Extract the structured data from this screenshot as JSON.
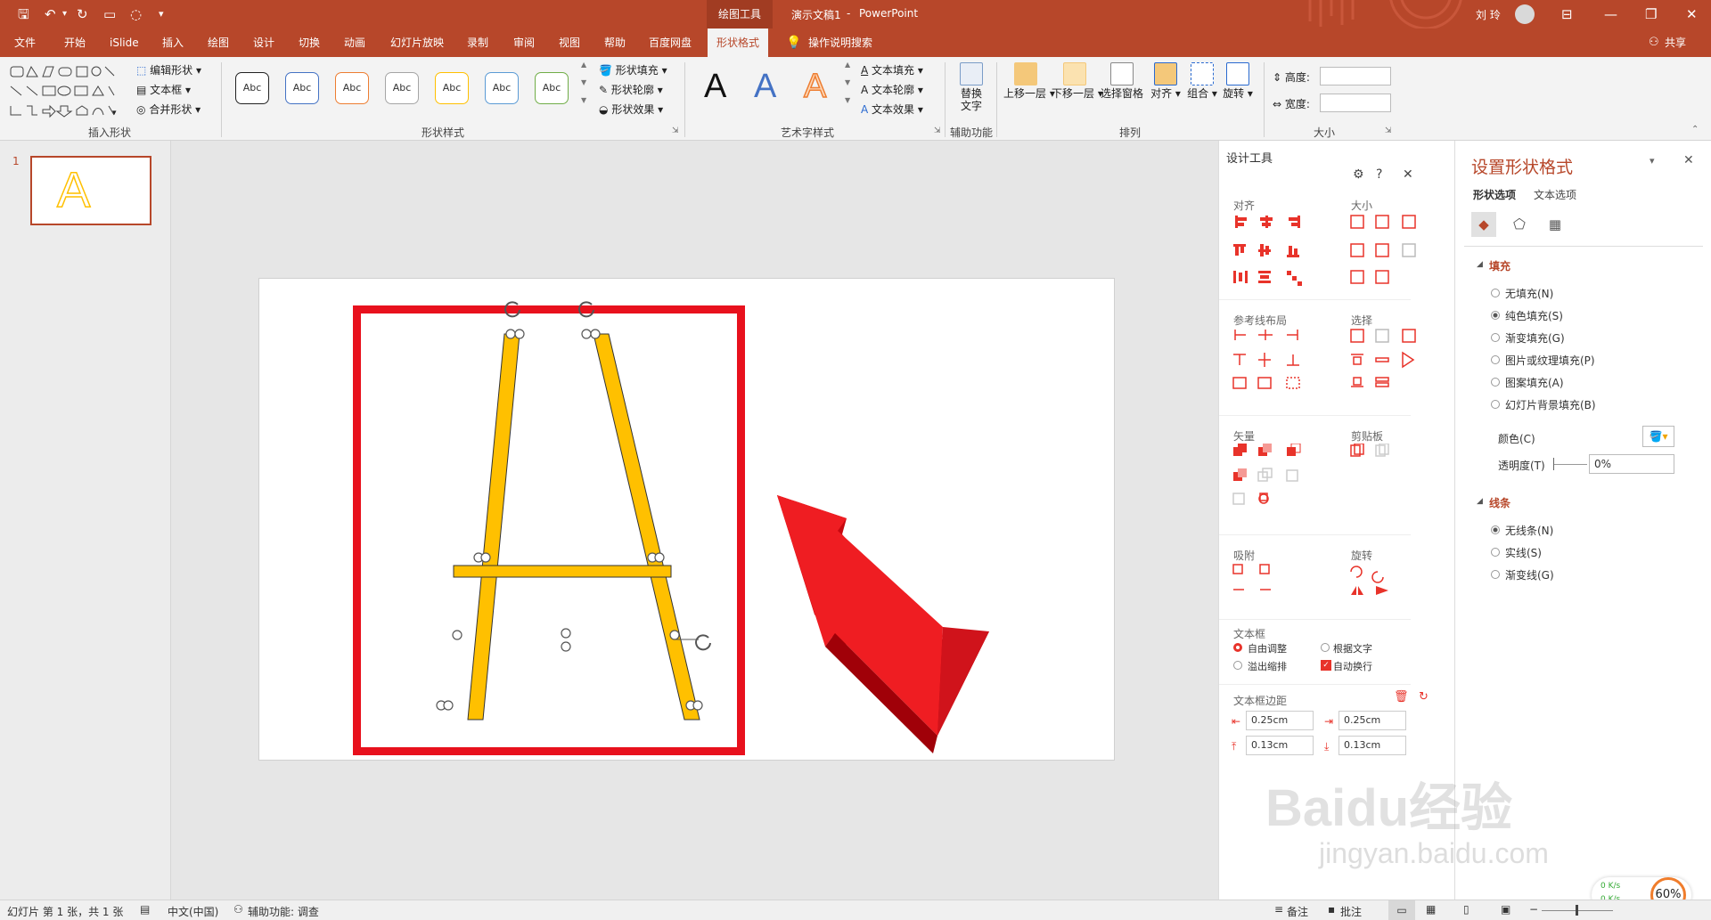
{
  "title_bar": {
    "context_tab": "绘图工具",
    "doc_title": "演示文稿1",
    "separator": "-",
    "app": "PowerPoint",
    "user": "刘 玲",
    "share": "共享"
  },
  "tabs": [
    "文件",
    "开始",
    "iSlide",
    "插入",
    "绘图",
    "设计",
    "切换",
    "动画",
    "幻灯片放映",
    "录制",
    "审阅",
    "视图",
    "帮助",
    "百度网盘",
    "形状格式"
  ],
  "tell_me": "操作说明搜索",
  "ribbon": {
    "insert_shapes": {
      "edit": "编辑形状",
      "textbox": "文本框",
      "merge": "合并形状",
      "label": "插入形状"
    },
    "shape_styles": {
      "sample": "Abc",
      "fill": "形状填充",
      "outline": "形状轮廓",
      "effect": "形状效果",
      "label": "形状样式"
    },
    "wordart": {
      "glyph": "A",
      "text_fill": "文本填充",
      "text_outline": "文本轮廓",
      "text_effect": "文本效果",
      "label": "艺术字样式"
    },
    "accessibility": {
      "alt_text_line1": "替换",
      "alt_text_line2": "文字",
      "label": "辅助功能"
    },
    "arrange": {
      "bring_forward": "上移一层",
      "send_backward": "下移一层",
      "selection_pane": "选择窗格",
      "align": "对齐",
      "group": "组合",
      "rotate": "旋转",
      "label": "排列"
    },
    "size": {
      "height": "高度:",
      "width": "宽度:",
      "label": "大小"
    }
  },
  "thumbnail": {
    "number": "1",
    "letter": "A"
  },
  "design_tools": {
    "title": "设计工具",
    "sections": {
      "align": "对齐",
      "size": "大小",
      "guides": "参考线布局",
      "select": "选择",
      "vector": "矢量",
      "clipboard": "剪贴板",
      "snap": "吸附",
      "rotate": "旋转",
      "textbox": "文本框",
      "margins": "文本框边距"
    },
    "textbox_opts": {
      "auto_fit": "自由调整",
      "fit_text": "根据文字",
      "overflow": "溢出缩排",
      "wrap": "自动换行"
    },
    "margins": {
      "left": "0.25cm",
      "right": "0.25cm",
      "top": "0.13cm",
      "bottom": "0.13cm"
    }
  },
  "format_pane": {
    "title": "设置形状格式",
    "tabs": [
      "形状选项",
      "文本选项"
    ],
    "fill_header": "填充",
    "fill_options": [
      "无填充(N)",
      "纯色填充(S)",
      "渐变填充(G)",
      "图片或纹理填充(P)",
      "图案填充(A)",
      "幻灯片背景填充(B)"
    ],
    "color_label": "颜色(C)",
    "transparency_label": "透明度(T)",
    "transparency_value": "0%",
    "line_header": "线条",
    "line_options": [
      "无线条(N)",
      "实线(S)",
      "渐变线(G)"
    ]
  },
  "status_bar": {
    "slide_info": "幻灯片 第 1 张，共 1 张",
    "language": "中文(中国)",
    "accessibility": "辅助功能: 调查",
    "notes": "备注",
    "comments": "批注"
  },
  "network": {
    "up": "0  K/s",
    "down": "0  K/s",
    "percent": "60%"
  },
  "watermark": {
    "brand": "Baidu经验",
    "url": "jingyan.baidu.com"
  },
  "colors": {
    "accent": "#b7472a",
    "highlight_red": "#e8111d",
    "shape_fill": "#ffc000",
    "design_icon_red": "#e8332a"
  }
}
